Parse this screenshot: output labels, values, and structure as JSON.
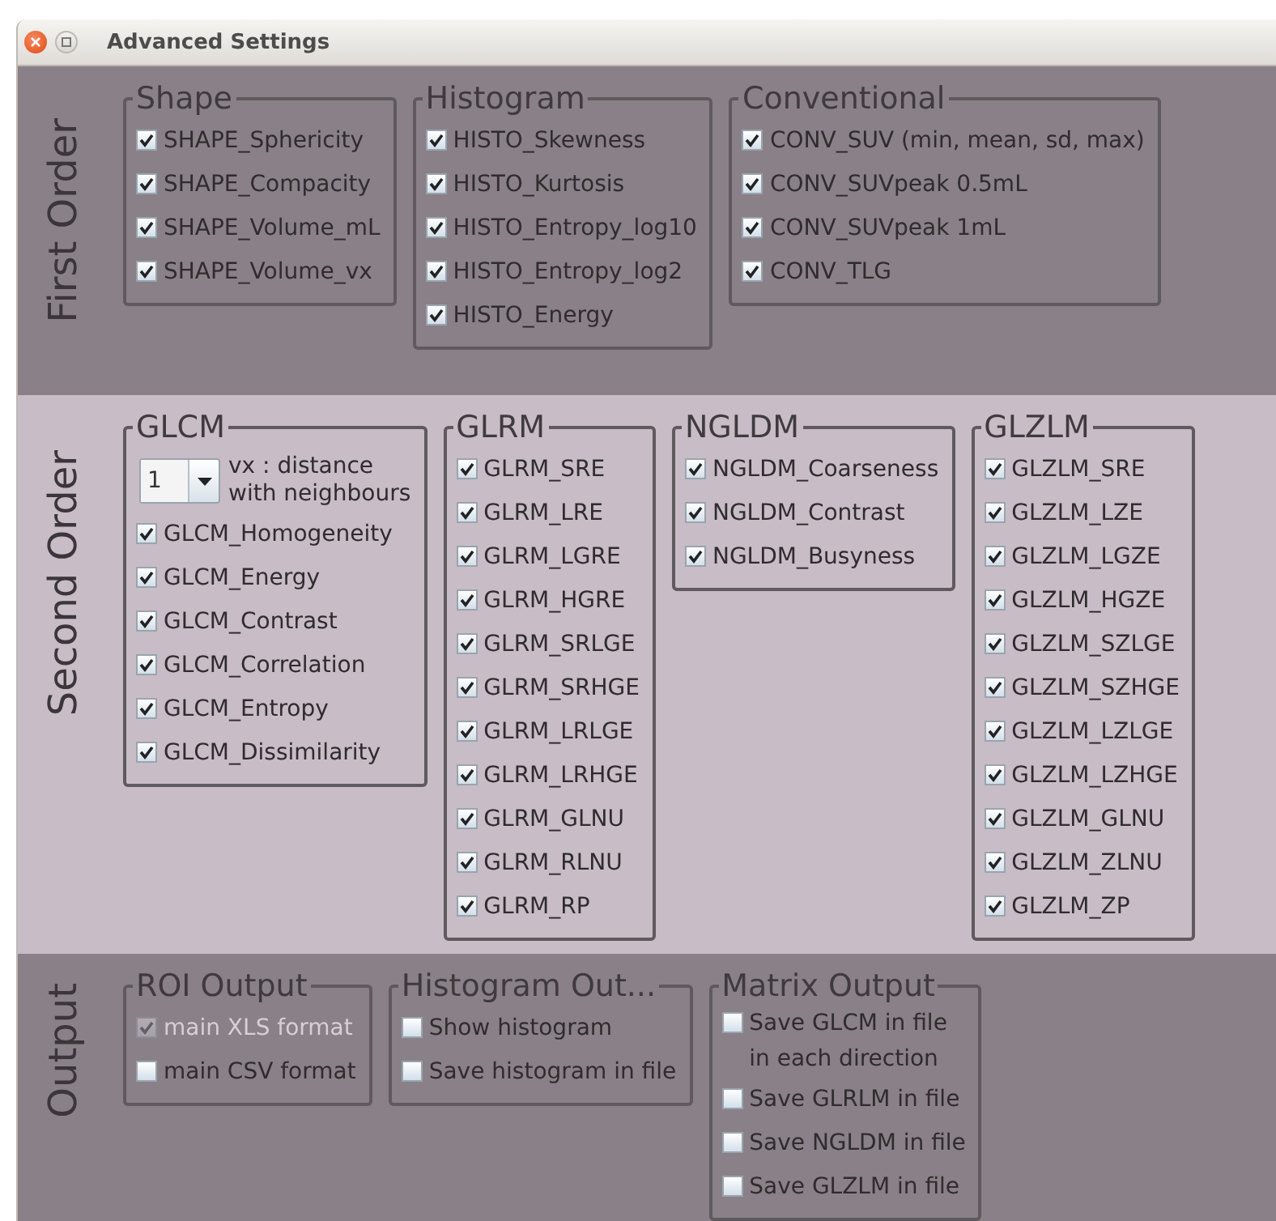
{
  "window": {
    "title": "Advanced Settings"
  },
  "sections": [
    {
      "label": "First Order",
      "kind": "dark",
      "groups": [
        {
          "title": "Shape",
          "items": [
            {
              "label": "SHAPE_Sphericity",
              "checked": true
            },
            {
              "label": "SHAPE_Compacity",
              "checked": true
            },
            {
              "label": "SHAPE_Volume_mL",
              "checked": true
            },
            {
              "label": "SHAPE_Volume_vx",
              "checked": true
            }
          ]
        },
        {
          "title": "Histogram",
          "items": [
            {
              "label": "HISTO_Skewness",
              "checked": true
            },
            {
              "label": "HISTO_Kurtosis",
              "checked": true
            },
            {
              "label": "HISTO_Entropy_log10",
              "checked": true
            },
            {
              "label": "HISTO_Entropy_log2",
              "checked": true
            },
            {
              "label": "HISTO_Energy",
              "checked": true
            }
          ]
        },
        {
          "title": "Conventional",
          "items": [
            {
              "label": "CONV_SUV (min, mean, sd, max)",
              "checked": true
            },
            {
              "label": "CONV_SUVpeak 0.5mL",
              "checked": true
            },
            {
              "label": "CONV_SUVpeak 1mL",
              "checked": true
            },
            {
              "label": "CONV_TLG",
              "checked": true
            }
          ]
        }
      ]
    },
    {
      "label": "Second Order",
      "kind": "light",
      "groups": [
        {
          "title": "GLCM",
          "combo": {
            "value": "1",
            "label": "vx : distance\nwith neighbours"
          },
          "items": [
            {
              "label": "GLCM_Homogeneity",
              "checked": true
            },
            {
              "label": "GLCM_Energy",
              "checked": true
            },
            {
              "label": "GLCM_Contrast",
              "checked": true
            },
            {
              "label": "GLCM_Correlation",
              "checked": true
            },
            {
              "label": "GLCM_Entropy",
              "checked": true
            },
            {
              "label": "GLCM_Dissimilarity",
              "checked": true
            }
          ]
        },
        {
          "title": "GLRM",
          "items": [
            {
              "label": "GLRM_SRE",
              "checked": true
            },
            {
              "label": "GLRM_LRE",
              "checked": true
            },
            {
              "label": "GLRM_LGRE",
              "checked": true
            },
            {
              "label": "GLRM_HGRE",
              "checked": true
            },
            {
              "label": "GLRM_SRLGE",
              "checked": true
            },
            {
              "label": "GLRM_SRHGE",
              "checked": true
            },
            {
              "label": "GLRM_LRLGE",
              "checked": true
            },
            {
              "label": "GLRM_LRHGE",
              "checked": true
            },
            {
              "label": "GLRM_GLNU",
              "checked": true
            },
            {
              "label": "GLRM_RLNU",
              "checked": true
            },
            {
              "label": "GLRM_RP",
              "checked": true
            }
          ]
        },
        {
          "title": "NGLDM",
          "items": [
            {
              "label": "NGLDM_Coarseness",
              "checked": true
            },
            {
              "label": "NGLDM_Contrast",
              "checked": true
            },
            {
              "label": "NGLDM_Busyness",
              "checked": true
            }
          ]
        },
        {
          "title": "GLZLM",
          "items": [
            {
              "label": "GLZLM_SRE",
              "checked": true
            },
            {
              "label": "GLZLM_LZE",
              "checked": true
            },
            {
              "label": "GLZLM_LGZE",
              "checked": true
            },
            {
              "label": "GLZLM_HGZE",
              "checked": true
            },
            {
              "label": "GLZLM_SZLGE",
              "checked": true
            },
            {
              "label": "GLZLM_SZHGE",
              "checked": true
            },
            {
              "label": "GLZLM_LZLGE",
              "checked": true
            },
            {
              "label": "GLZLM_LZHGE",
              "checked": true
            },
            {
              "label": "GLZLM_GLNU",
              "checked": true
            },
            {
              "label": "GLZLM_ZLNU",
              "checked": true
            },
            {
              "label": "GLZLM_ZP",
              "checked": true
            }
          ]
        }
      ]
    },
    {
      "label": "Output",
      "kind": "dark",
      "groups": [
        {
          "title": "ROI Output",
          "items": [
            {
              "label": "main XLS format",
              "checked": true,
              "disabled": true
            },
            {
              "label": "main CSV format",
              "checked": false,
              "disabled": false
            }
          ]
        },
        {
          "title": "Histogram Out...",
          "items": [
            {
              "label": "Show histogram",
              "checked": false
            },
            {
              "label": "Save histogram in file",
              "checked": false
            }
          ]
        },
        {
          "title": "Matrix Output",
          "items": [
            {
              "label": "Save GLCM in file\nin each direction",
              "checked": false
            },
            {
              "label": "Save GLRLM in file",
              "checked": false
            },
            {
              "label": "Save NGLDM in file",
              "checked": false
            },
            {
              "label": "Save GLZLM in file",
              "checked": false
            }
          ]
        }
      ]
    }
  ]
}
